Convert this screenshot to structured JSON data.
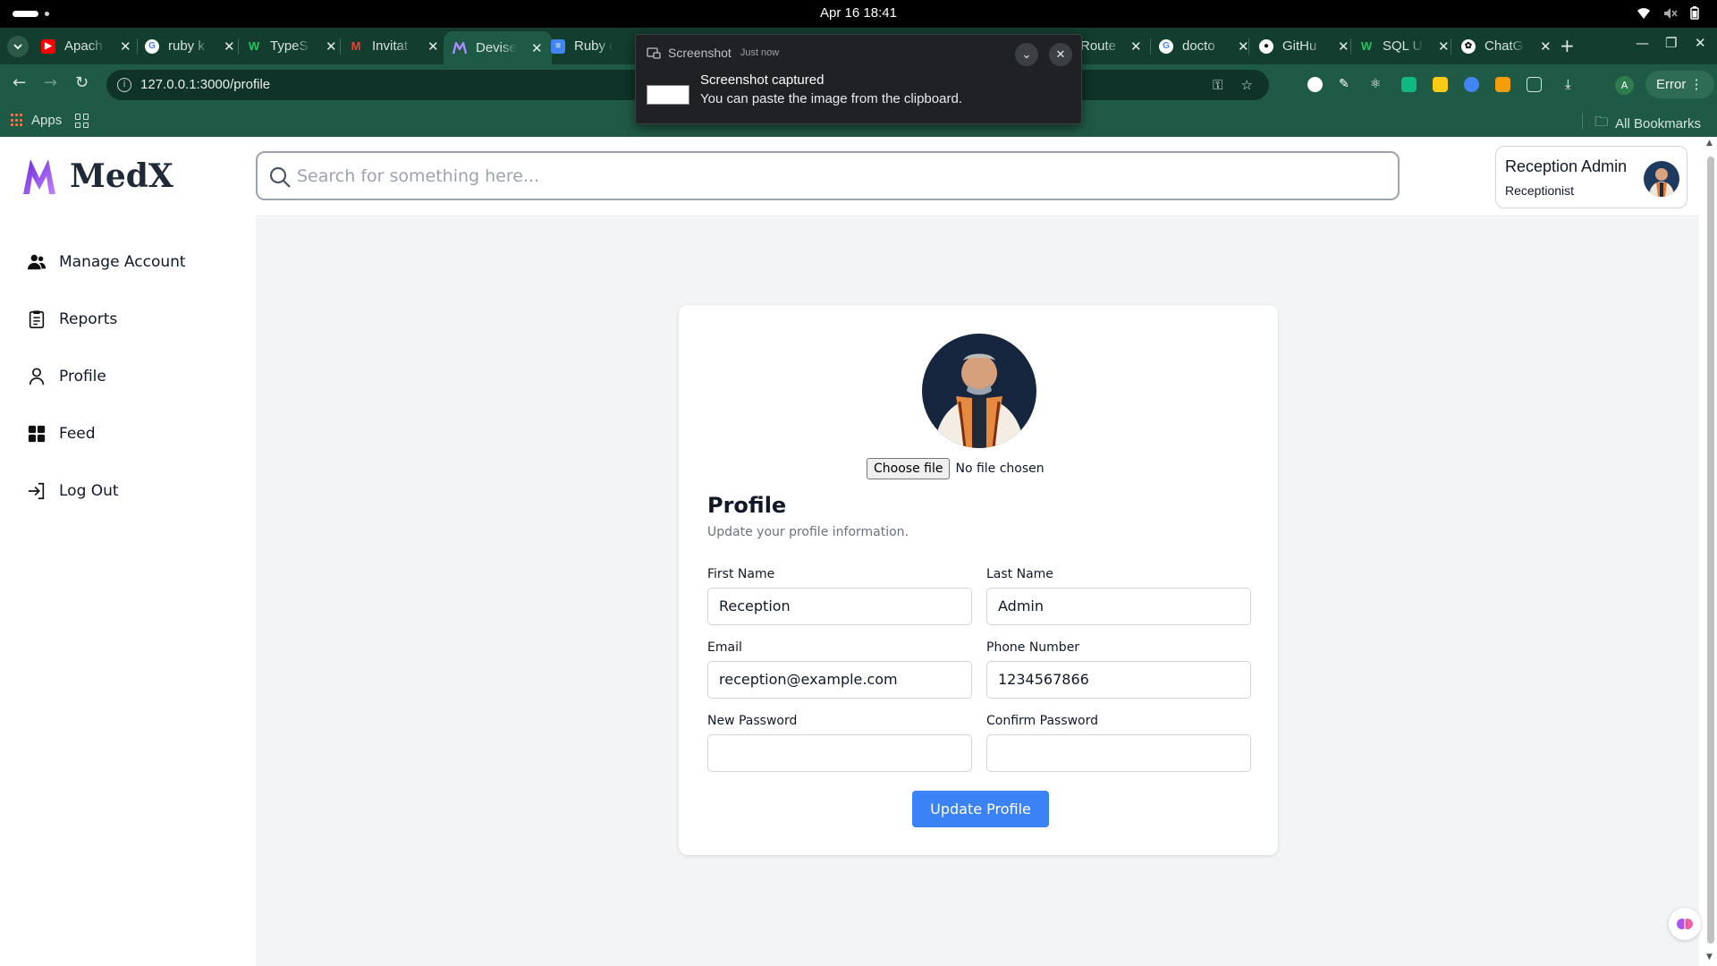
{
  "os": {
    "clock": "Apr 16  18:41"
  },
  "browser": {
    "tabs": [
      {
        "label": "Apach",
        "favicon": "youtube-icon",
        "color": "#ff0000"
      },
      {
        "label": "ruby k",
        "favicon": "google-icon",
        "color": "#ffffff"
      },
      {
        "label": "TypeS",
        "favicon": "w-icon",
        "color": "#16a34a"
      },
      {
        "label": "Invitat",
        "favicon": "gmail-icon",
        "color": "#ea4335"
      },
      {
        "label": "Devise",
        "favicon": "medx-icon",
        "color": "#7c3aed",
        "active": true
      },
      {
        "label": "Ruby c",
        "favicon": "docs-icon",
        "color": "#4285f4"
      },
      {
        "label": "Route",
        "favicon": "",
        "color": "#123d2f"
      },
      {
        "label": "docto",
        "favicon": "google-icon",
        "color": "#ffffff"
      },
      {
        "label": "GitHu",
        "favicon": "github-icon",
        "color": "#ffffff"
      },
      {
        "label": "SQL U",
        "favicon": "w-icon",
        "color": "#16a34a"
      },
      {
        "label": "ChatG",
        "favicon": "chatgpt-icon",
        "color": "#ffffff"
      }
    ],
    "url": "127.0.0.1:3000/profile",
    "account_initial": "A",
    "error_label": "Error",
    "bookmarks": {
      "apps_label": "Apps",
      "all_label": "All Bookmarks"
    }
  },
  "notification": {
    "app": "Screenshot",
    "time": "Just now",
    "title": "Screenshot captured",
    "body": "You can paste the image from the clipboard."
  },
  "app": {
    "brand": "MedX",
    "nav": [
      {
        "label": "Manage Account",
        "icon": "users-icon"
      },
      {
        "label": "Reports",
        "icon": "clipboard-icon"
      },
      {
        "label": "Profile",
        "icon": "user-icon"
      },
      {
        "label": "Feed",
        "icon": "grid-icon"
      },
      {
        "label": "Log Out",
        "icon": "logout-icon"
      }
    ],
    "search": {
      "placeholder": "Search for something here..."
    },
    "user": {
      "name": "Reception Admin",
      "role": "Receptionist"
    }
  },
  "profile": {
    "file_button": "Choose file",
    "file_status": "No file chosen",
    "title": "Profile",
    "subtitle": "Update your profile information.",
    "fields": {
      "first_name": {
        "label": "First Name",
        "value": "Reception"
      },
      "last_name": {
        "label": "Last Name",
        "value": "Admin"
      },
      "email": {
        "label": "Email",
        "value": "reception@example.com"
      },
      "phone": {
        "label": "Phone Number",
        "value": "1234567866"
      },
      "new_password": {
        "label": "New Password",
        "value": ""
      },
      "confirm_password": {
        "label": "Confirm Password",
        "value": ""
      }
    },
    "submit": "Update Profile"
  },
  "colors": {
    "chrome_tabstrip": "#123d2f",
    "chrome_toolbar": "#1f5a46",
    "primary": "#3b82f6",
    "brand_purple": "#7c3aed"
  }
}
